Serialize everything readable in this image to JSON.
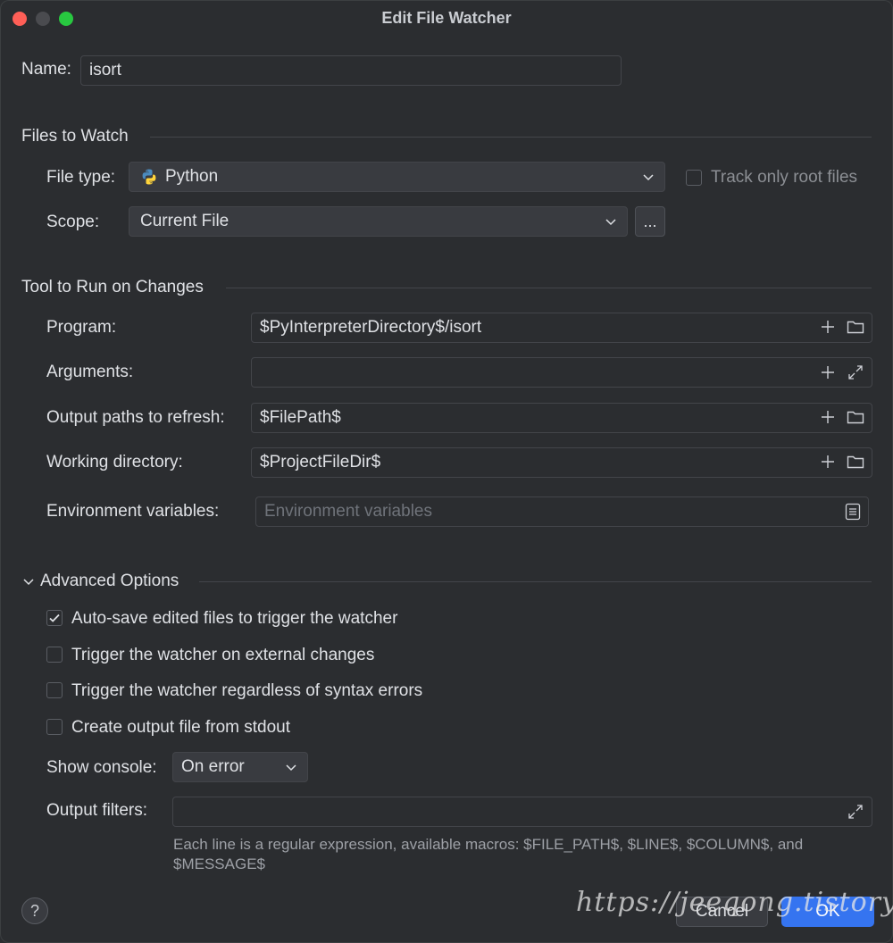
{
  "window": {
    "title": "Edit File Watcher"
  },
  "name": {
    "label": "Name:",
    "value": "isort"
  },
  "files_to_watch": {
    "title": "Files to Watch",
    "file_type_label": "File type:",
    "file_type_value": "Python",
    "track_root_label": "Track only root files",
    "track_root_checked": false,
    "scope_label": "Scope:",
    "scope_value": "Current File",
    "scope_more": "..."
  },
  "tool": {
    "title": "Tool to Run on Changes",
    "program_label": "Program:",
    "program_value": "$PyInterpreterDirectory$/isort",
    "arguments_label": "Arguments:",
    "arguments_value": "",
    "output_paths_label": "Output paths to refresh:",
    "output_paths_value": "$FilePath$",
    "working_dir_label": "Working directory:",
    "working_dir_value": "$ProjectFileDir$",
    "env_label": "Environment variables:",
    "env_placeholder": "Environment variables"
  },
  "advanced": {
    "title": "Advanced Options",
    "expanded": true,
    "options": [
      {
        "label": "Auto-save edited files to trigger the watcher",
        "checked": true
      },
      {
        "label": "Trigger the watcher on external changes",
        "checked": false
      },
      {
        "label": "Trigger the watcher regardless of syntax errors",
        "checked": false
      },
      {
        "label": "Create output file from stdout",
        "checked": false
      }
    ],
    "show_console_label": "Show console:",
    "show_console_value": "On error",
    "output_filters_label": "Output filters:",
    "output_filters_value": "",
    "hint": "Each line is a regular expression, available macros: $FILE_PATH$, $LINE$, $COLUMN$, and $MESSAGE$"
  },
  "buttons": {
    "help": "?",
    "cancel": "Cancel",
    "ok": "OK"
  },
  "watermark": "https://jeeqong.tistory.com",
  "icons": {
    "python": "python-icon",
    "chevron": "chevron-down-icon",
    "add": "plus-icon",
    "folder": "folder-icon",
    "expand": "expand-icon",
    "list": "list-icon",
    "check": "check-icon"
  },
  "colors": {
    "accent": "#3574f0",
    "background": "#2b2d30",
    "field_border": "#43454a"
  }
}
